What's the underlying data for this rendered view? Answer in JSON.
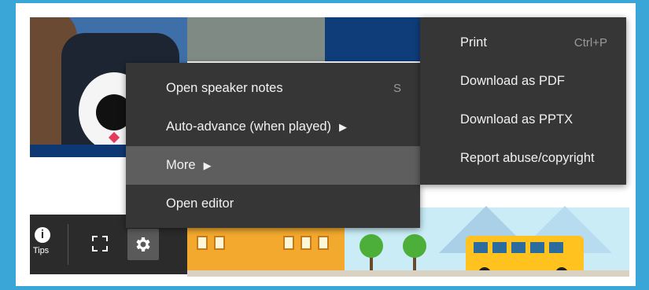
{
  "controls": {
    "tips_label": "Tips",
    "info_glyph": "i",
    "icons": [
      "info-icon",
      "fullscreen-icon",
      "gear-icon"
    ]
  },
  "menu": {
    "items": [
      {
        "label": "Open speaker notes",
        "shortcut": "S"
      },
      {
        "label": "Auto-advance (when played)",
        "arrow": "▶"
      },
      {
        "label": "More",
        "arrow": "▶",
        "highlighted": true
      },
      {
        "label": "Open editor"
      }
    ]
  },
  "submenu": {
    "items": [
      {
        "label": "Print",
        "shortcut": "Ctrl+P"
      },
      {
        "label": "Download as PDF"
      },
      {
        "label": "Download as PPTX"
      },
      {
        "label": "Report abuse/copyright"
      }
    ]
  },
  "colors": {
    "background": "#3aa6d8",
    "menu_bg": "#363636",
    "menu_highlight": "#5e5e5e",
    "control_bar": "#2b2b2b",
    "accent_navy": "#0e3873"
  }
}
